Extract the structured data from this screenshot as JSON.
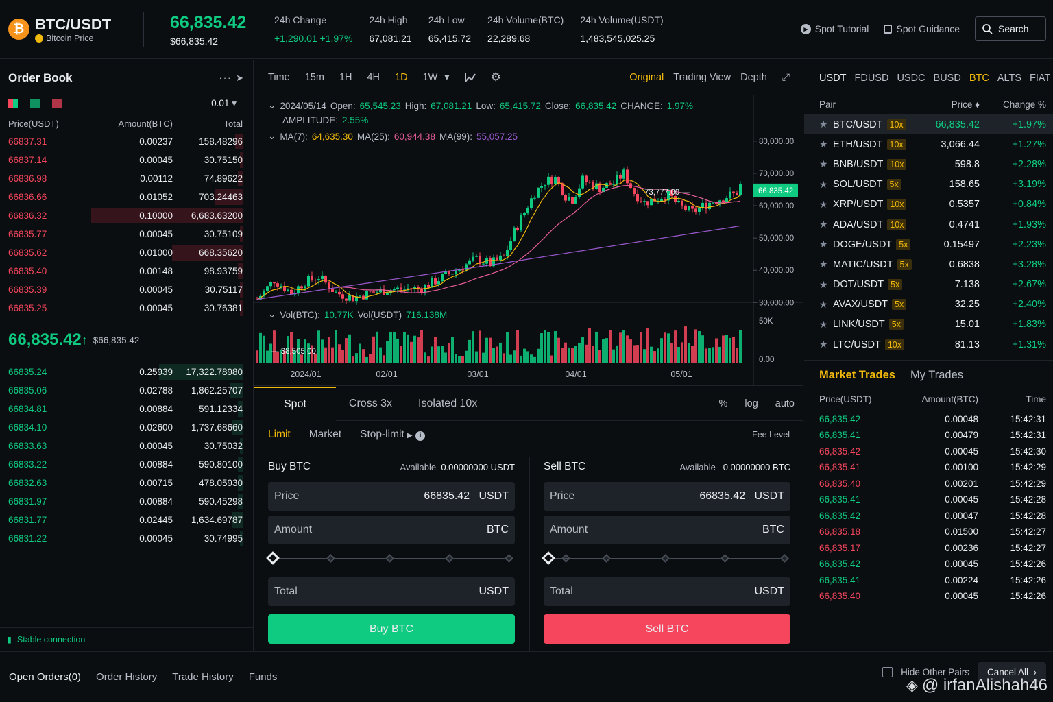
{
  "header": {
    "pair": "BTC/USDT",
    "coin_sub": "Bitcoin Price",
    "last_price": "66,835.42",
    "last_price_usd": "$66,835.42",
    "stats": [
      {
        "label": "24h Change",
        "value": "+1,290.01 +1.97%",
        "color": "#0ecb81"
      },
      {
        "label": "24h High",
        "value": "67,081.21"
      },
      {
        "label": "24h Low",
        "value": "65,415.72"
      },
      {
        "label": "24h Volume(BTC)",
        "value": "22,289.68"
      },
      {
        "label": "24h Volume(USDT)",
        "value": "1,483,545,025.25"
      }
    ],
    "spot_tutorial": "Spot Tutorial",
    "spot_guidance": "Spot Guidance",
    "search": "Search"
  },
  "orderbook": {
    "title": "Order Book",
    "precision": "0.01",
    "col_price": "Price(USDT)",
    "col_amount": "Amount(BTC)",
    "col_total": "Total",
    "asks": [
      [
        "66837.31",
        "0.00237",
        "158.48296",
        0.03
      ],
      [
        "66837.14",
        "0.00045",
        "30.75150",
        0.01
      ],
      [
        "66836.98",
        "0.00112",
        "74.89622",
        0.02
      ],
      [
        "66836.66",
        "0.01052",
        "703.24463",
        0.11
      ],
      [
        "66836.32",
        "0.10000",
        "6,683.63200",
        0.6
      ],
      [
        "66835.77",
        "0.00045",
        "30.75109",
        0.01
      ],
      [
        "66835.62",
        "0.01000",
        "668.35620",
        0.28
      ],
      [
        "66835.40",
        "0.00148",
        "98.93759",
        0.02
      ],
      [
        "66835.39",
        "0.00045",
        "30.75117",
        0.01
      ],
      [
        "66835.25",
        "0.00045",
        "30.76381",
        0.01
      ]
    ],
    "mid_price": "66,835.42",
    "mid_arrow": "↑",
    "mid_usd": "$66,835.42",
    "bids": [
      [
        "66835.24",
        "0.25939",
        "17,322.78980",
        0.33
      ],
      [
        "66835.06",
        "0.02788",
        "1,862.25707",
        0.05
      ],
      [
        "66834.81",
        "0.00884",
        "591.12334",
        0.02
      ],
      [
        "66834.10",
        "0.02600",
        "1,737.68660",
        0.04
      ],
      [
        "66833.63",
        "0.00045",
        "30.75032",
        0.01
      ],
      [
        "66833.22",
        "0.00884",
        "590.80100",
        0.02
      ],
      [
        "66832.63",
        "0.00715",
        "478.05930",
        0.02
      ],
      [
        "66831.97",
        "0.00884",
        "590.45298",
        0.02
      ],
      [
        "66831.77",
        "0.02445",
        "1,634.69787",
        0.04
      ],
      [
        "66831.22",
        "0.00045",
        "30.74995",
        0.01
      ]
    ],
    "status": "Stable connection"
  },
  "chart": {
    "intervals": [
      "Time",
      "15m",
      "1H",
      "4H",
      "1D",
      "1W"
    ],
    "active_interval": "1D",
    "views": [
      "Original",
      "Trading View",
      "Depth"
    ],
    "active_view": "Original",
    "ohlc": {
      "date": "2024/05/14",
      "open_label": "Open:",
      "open": "65,545.23",
      "high_label": "High:",
      "high": "67,081.21",
      "low_label": "Low:",
      "low": "65,415.72",
      "close_label": "Close:",
      "close": "66,835.42",
      "change_label": "CHANGE:",
      "change": "1.97%",
      "amp_label": "AMPLITUDE:",
      "amp": "2.55%"
    },
    "ma": {
      "ma7_label": "MA(7):",
      "ma7": "64,635.30",
      "ma25_label": "MA(25):",
      "ma25": "60,944.38",
      "ma99_label": "MA(99):",
      "ma99": "55,057.25"
    },
    "hi_marker": "73,777.00",
    "lo_marker": "38,505.00",
    "price_tag": "66,835.42",
    "y_ticks": [
      "80,000.00",
      "70,000.00",
      "60,000.00",
      "50,000.00",
      "40,000.00",
      "30,000.00"
    ],
    "vol": {
      "btc_label": "Vol(BTC):",
      "btc": "10.77K",
      "usdt_label": "Vol(USDT)",
      "usdt": "716.138M",
      "ticks": [
        "50K",
        "0.00"
      ]
    },
    "x_ticks": [
      "2024/01",
      "02/01",
      "03/01",
      "04/01",
      "05/01"
    ],
    "colors": {
      "up": "#0ecb81",
      "down": "#f6465d",
      "ma7": "#f0b90b",
      "ma25": "#e85d9b",
      "ma99": "#9b59d0"
    }
  },
  "trade": {
    "tabs": [
      "Spot",
      "Cross 3x",
      "Isolated 10x"
    ],
    "right": [
      "%",
      "log",
      "auto"
    ],
    "order_types": [
      "Limit",
      "Market",
      "Stop-limit"
    ],
    "fee": "Fee Level",
    "buy": {
      "title": "Buy BTC",
      "avail_label": "Available",
      "avail": "0.00000000 USDT",
      "price_label": "Price",
      "price": "66835.42",
      "price_unit": "USDT",
      "amount_label": "Amount",
      "amount_unit": "BTC",
      "total_label": "Total",
      "total_unit": "USDT",
      "button": "Buy BTC"
    },
    "sell": {
      "title": "Sell BTC",
      "avail_label": "Available",
      "avail": "0.00000000 BTC",
      "price_label": "Price",
      "price": "66835.42",
      "price_unit": "USDT",
      "amount_label": "Amount",
      "amount_unit": "BTC",
      "total_label": "Total",
      "total_unit": "USDT",
      "button": "Sell BTC"
    }
  },
  "market": {
    "tabs": [
      "USDT",
      "FDUSD",
      "USDC",
      "BUSD",
      "BTC",
      "ALTS",
      "FIAT"
    ],
    "active_tab": "BTC",
    "col_pair": "Pair",
    "col_price": "Price ♦",
    "col_change": "Change %",
    "rows": [
      [
        "BTC/USDT",
        "10x",
        "66,835.42",
        "+1.97%"
      ],
      [
        "ETH/USDT",
        "10x",
        "3,066.44",
        "+1.27%"
      ],
      [
        "BNB/USDT",
        "10x",
        "598.8",
        "+2.28%"
      ],
      [
        "SOL/USDT",
        "5x",
        "158.65",
        "+3.19%"
      ],
      [
        "XRP/USDT",
        "10x",
        "0.5357",
        "+0.84%"
      ],
      [
        "ADA/USDT",
        "10x",
        "0.4741",
        "+1.93%"
      ],
      [
        "DOGE/USDT",
        "5x",
        "0.15497",
        "+2.23%"
      ],
      [
        "MATIC/USDT",
        "5x",
        "0.6838",
        "+3.28%"
      ],
      [
        "DOT/USDT",
        "5x",
        "7.138",
        "+2.67%"
      ],
      [
        "AVAX/USDT",
        "5x",
        "32.25",
        "+2.40%"
      ],
      [
        "LINK/USDT",
        "5x",
        "15.01",
        "+1.83%"
      ],
      [
        "LTC/USDT",
        "10x",
        "81.13",
        "+1.31%"
      ]
    ]
  },
  "trades": {
    "tabs": [
      "Market Trades",
      "My Trades"
    ],
    "col_price": "Price(USDT)",
    "col_amount": "Amount(BTC)",
    "col_time": "Time",
    "rows": [
      [
        "66,835.42",
        "0.00048",
        "15:42:31",
        "up"
      ],
      [
        "66,835.41",
        "0.00479",
        "15:42:31",
        "up"
      ],
      [
        "66,835.42",
        "0.00045",
        "15:42:30",
        "down"
      ],
      [
        "66,835.41",
        "0.00100",
        "15:42:29",
        "down"
      ],
      [
        "66,835.40",
        "0.00201",
        "15:42:29",
        "down"
      ],
      [
        "66,835.41",
        "0.00045",
        "15:42:28",
        "up"
      ],
      [
        "66,835.42",
        "0.00047",
        "15:42:28",
        "up"
      ],
      [
        "66,835.18",
        "0.01500",
        "15:42:27",
        "down"
      ],
      [
        "66,835.17",
        "0.00236",
        "15:42:27",
        "down"
      ],
      [
        "66,835.42",
        "0.00045",
        "15:42:26",
        "up"
      ],
      [
        "66,835.41",
        "0.00224",
        "15:42:26",
        "up"
      ],
      [
        "66,835.40",
        "0.00045",
        "15:42:26",
        "down"
      ]
    ]
  },
  "bottom": {
    "tabs": [
      "Open Orders(0)",
      "Order History",
      "Trade History",
      "Funds"
    ],
    "hide_pairs": "Hide Other Pairs",
    "cancel_all": "Cancel All",
    "watermark": "@ irfanAlishah46"
  }
}
